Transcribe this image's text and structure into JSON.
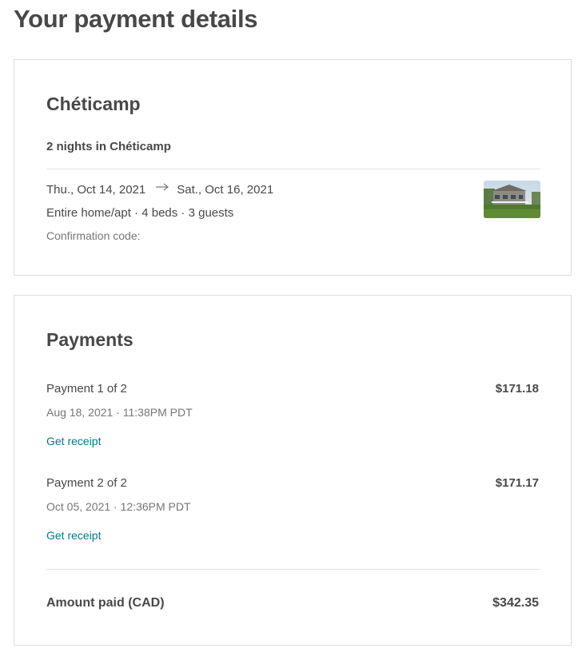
{
  "page": {
    "title": "Your payment details"
  },
  "trip": {
    "heading": "Chéticamp",
    "nights": "2 nights in Chéticamp",
    "check_in": "Thu., Oct 14, 2021",
    "check_out": "Sat., Oct 16, 2021",
    "arrow_icon": "arrow-right-icon",
    "details": "Entire home/apt · 4 beds · 3 guests",
    "confirmation_label": "Confirmation code:",
    "photo": "listing-photo"
  },
  "payments": {
    "heading": "Payments",
    "items": [
      {
        "title": "Payment 1 of 2",
        "amount": "$171.18",
        "date": "Aug 18, 2021 · 11:38PM PDT",
        "receipt_label": "Get receipt"
      },
      {
        "title": "Payment 2 of 2",
        "amount": "$171.17",
        "date": "Oct 05, 2021 · 12:36PM PDT",
        "receipt_label": "Get receipt"
      }
    ],
    "total_label": "Amount paid (CAD)",
    "total_amount": "$342.35"
  },
  "colors": {
    "text": "#484848",
    "muted": "#767676",
    "link": "#007a87",
    "border": "#dddddd"
  }
}
